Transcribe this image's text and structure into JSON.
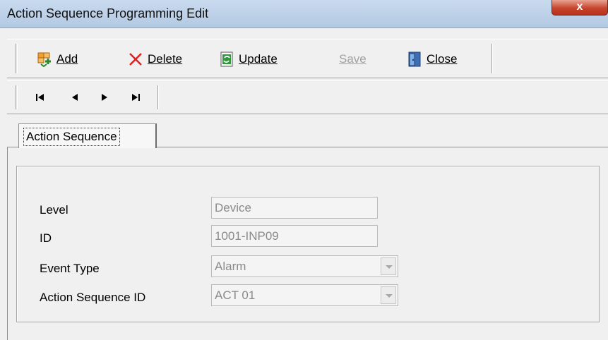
{
  "window": {
    "title": "Action Sequence Programming Edit",
    "close_glyph": "x"
  },
  "toolbar": {
    "add_label": "Add",
    "delete_label": "Delete",
    "update_label": "Update",
    "save_label": "Save",
    "close_label": "Close",
    "save_enabled": false,
    "icons": {
      "add": "add-record-icon",
      "delete": "red-x-delete-icon",
      "update": "green-refresh-icon",
      "close": "door-exit-icon"
    }
  },
  "navigation": {
    "icons": [
      "first-record-icon",
      "previous-record-icon",
      "next-record-icon",
      "last-record-icon"
    ]
  },
  "tabs": [
    {
      "label": "Action Sequence",
      "selected": true
    }
  ],
  "form": {
    "level": {
      "label": "Level",
      "value": "Device"
    },
    "id": {
      "label": "ID",
      "value": "1001-INP09"
    },
    "event_type": {
      "label": "Event Type",
      "value": "Alarm"
    },
    "action_sequence_id": {
      "label": "Action Sequence ID",
      "value": "ACT 01"
    }
  },
  "colors": {
    "titlebar": "#b9cde5",
    "close_button": "#c7442d",
    "disabled_text": "#8a8a8a"
  }
}
